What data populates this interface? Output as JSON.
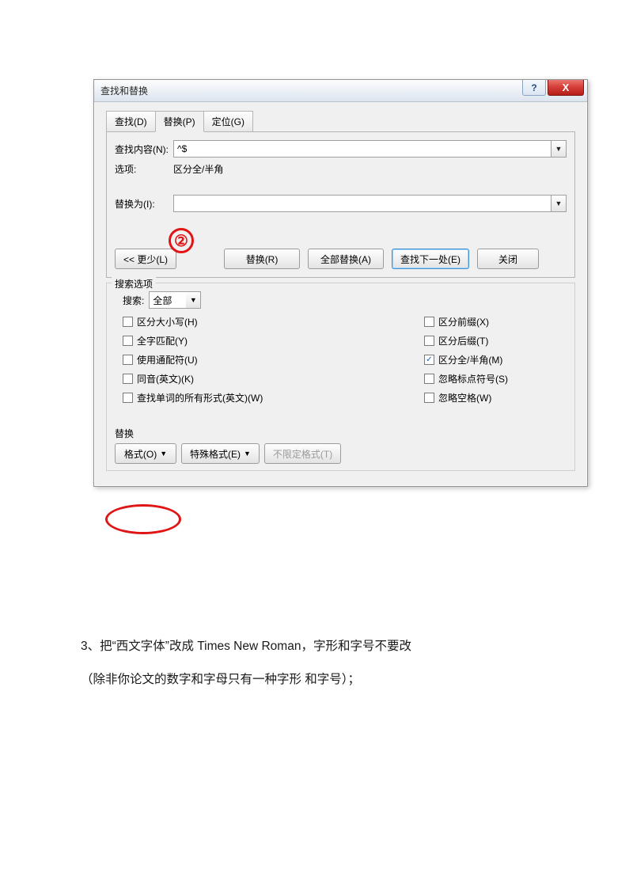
{
  "dialog": {
    "title": "查找和替换",
    "help_glyph": "?",
    "close_glyph": "X",
    "tabs": {
      "find": "查找(D)",
      "replace": "替换(P)",
      "goto": "定位(G)"
    },
    "find_label": "查找内容(N):",
    "find_value": "^$",
    "options_label": "选项:",
    "options_value": "区分全/半角",
    "replace_label": "替换为(I):",
    "replace_value": "",
    "buttons": {
      "less": "<<  更少(L)",
      "replace": "替换(R)",
      "replace_all": "全部替换(A)",
      "find_next": "查找下一处(E)",
      "close": "关闭"
    },
    "search_options_legend": "搜索选项",
    "search_label": "搜索:",
    "search_scope": "全部",
    "checks_left": [
      "区分大小写(H)",
      "全字匹配(Y)",
      "使用通配符(U)",
      "同音(英文)(K)",
      "查找单词的所有形式(英文)(W)"
    ],
    "checks_right": [
      {
        "label": "区分前缀(X)",
        "checked": false
      },
      {
        "label": "区分后缀(T)",
        "checked": false
      },
      {
        "label": "区分全/半角(M)",
        "checked": true
      },
      {
        "label": "忽略标点符号(S)",
        "checked": false
      },
      {
        "label": "忽略空格(W)",
        "checked": false
      }
    ],
    "replace_section": "替换",
    "format_btn": "格式(O)",
    "special_btn": "特殊格式(E)",
    "noformat_btn": "不限定格式(T)"
  },
  "annotation2": "②",
  "body_line1": "3、把“西文字体”改成 Times New Roman，字形和字号不要改",
  "body_line2": "（除非你论文的数字和字母只有一种字形 和字号）；"
}
